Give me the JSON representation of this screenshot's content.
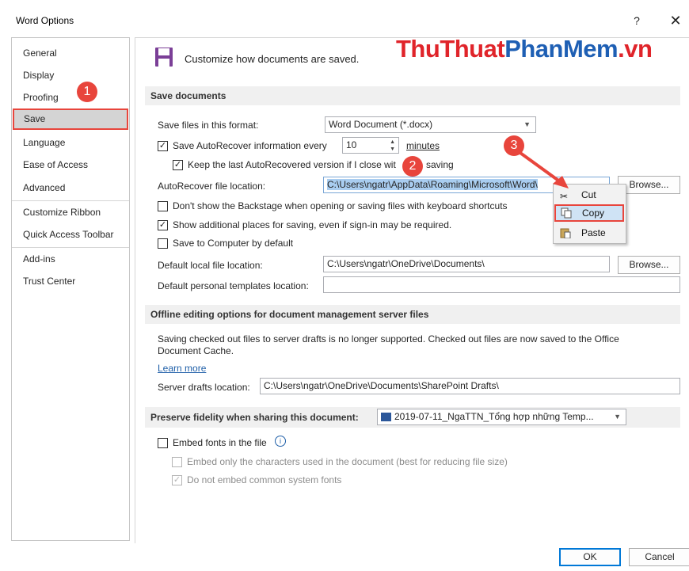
{
  "window": {
    "title": "Word Options",
    "help": "?",
    "close": "✕"
  },
  "watermark": {
    "part1": "Thu",
    "part2": "Thuat",
    "part3": "PhanMem",
    "part4": ".vn"
  },
  "sidebar": {
    "items": [
      {
        "label": "General"
      },
      {
        "label": "Display"
      },
      {
        "label": "Proofing"
      },
      {
        "label": "Save"
      },
      {
        "label": "Language"
      },
      {
        "label": "Ease of Access"
      },
      {
        "label": "Advanced"
      },
      {
        "label": "Customize Ribbon"
      },
      {
        "label": "Quick Access Toolbar"
      },
      {
        "label": "Add-ins"
      },
      {
        "label": "Trust Center"
      }
    ]
  },
  "header": {
    "text": "Customize how documents are saved."
  },
  "save_documents": {
    "heading": "Save documents",
    "format_label": "Save files in this format:",
    "format_value": "Word Document (*.docx)",
    "autorecover_label": "Save AutoRecover information every",
    "autorecover_minutes": "10",
    "minutes_label": "minutes",
    "keep_last_label_a": "Keep the last AutoRecovered version if I close wit",
    "keep_last_label_b": "saving",
    "ar_location_label": "AutoRecover file location:",
    "ar_location_value": "C:\\Users\\ngatr\\AppData\\Roaming\\Microsoft\\Word\\",
    "browse": "Browse...",
    "dont_show_backstage": "Don't show the Backstage when opening or saving files with keyboard shortcuts",
    "show_additional": "Show additional places for saving, even if sign-in may be required.",
    "save_to_computer": "Save to Computer by default",
    "default_local_label": "Default local file location:",
    "default_local_value": "C:\\Users\\ngatr\\OneDrive\\Documents\\",
    "default_templates_label": "Default personal templates location:",
    "default_templates_value": ""
  },
  "offline": {
    "heading": "Offline editing options for document management server files",
    "text": "Saving checked out files to server drafts is no longer supported. Checked out files are now saved to the Office Document Cache.",
    "learn_more": "Learn more",
    "server_drafts_label": "Server drafts location:",
    "server_drafts_value": "C:\\Users\\ngatr\\OneDrive\\Documents\\SharePoint Drafts\\"
  },
  "fidelity": {
    "heading": "Preserve fidelity when sharing this document:",
    "document": "2019-07-11_NgaTTN_Tổng hợp những Temp...",
    "embed_fonts": "Embed fonts in the file",
    "embed_only": "Embed only the characters used in the document (best for reducing file size)",
    "do_not_embed": "Do not embed common system fonts"
  },
  "context_menu": {
    "items": [
      {
        "label": "Cut"
      },
      {
        "label": "Copy"
      },
      {
        "label": "Paste"
      }
    ]
  },
  "badges": {
    "one": "1",
    "two": "2",
    "three": "3"
  },
  "footer": {
    "ok": "OK",
    "cancel": "Cancel"
  },
  "colors": {
    "accent_red": "#e8453c",
    "selection_blue": "#cce4f7",
    "link_blue": "#1f5fa8"
  }
}
